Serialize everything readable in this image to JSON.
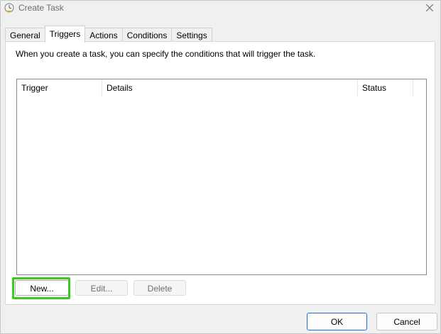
{
  "window": {
    "title": "Create Task",
    "icon": "task-scheduler-clock-icon"
  },
  "tabs": [
    {
      "label": "General",
      "active": false
    },
    {
      "label": "Triggers",
      "active": true
    },
    {
      "label": "Actions",
      "active": false
    },
    {
      "label": "Conditions",
      "active": false
    },
    {
      "label": "Settings",
      "active": false
    }
  ],
  "triggers_panel": {
    "description": "When you create a task, you can specify the conditions that will trigger the task.",
    "columns": [
      "Trigger",
      "Details",
      "Status"
    ],
    "rows": [],
    "buttons": {
      "new": "New...",
      "edit": "Edit...",
      "delete": "Delete"
    }
  },
  "footer": {
    "ok": "OK",
    "cancel": "Cancel"
  },
  "colors": {
    "highlight": "#3dca20",
    "ok_border": "#1e6fd0"
  }
}
